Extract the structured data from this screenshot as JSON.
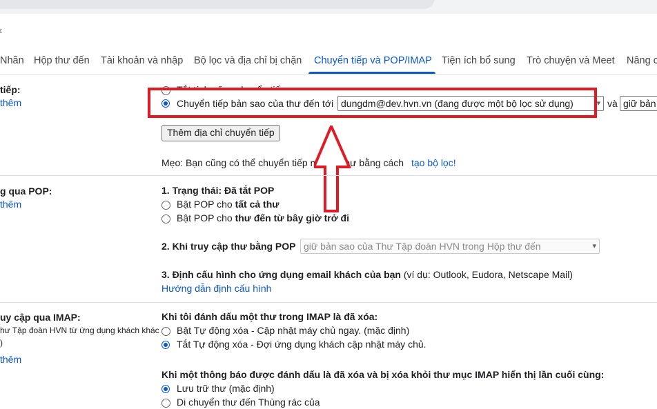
{
  "tabs": [
    {
      "label": "Nhãn"
    },
    {
      "label": "Hộp thư đến"
    },
    {
      "label": "Tài khoản và nhập"
    },
    {
      "label": "Bộ lọc và địa chỉ bị chặn"
    },
    {
      "label": "Chuyển tiếp và POP/IMAP"
    },
    {
      "label": "Tiện ích bổ sung"
    },
    {
      "label": "Trò chuyện và Meet"
    },
    {
      "label": "Nâng c"
    }
  ],
  "forwarding": {
    "section_label": "tiếp:",
    "learn_more": "thêm",
    "disable_option": "Tắt tính năng chuyển tiếp",
    "forward_option": "Chuyển tiếp bản sao của thư đến tới",
    "forward_address": "dungdm@dev.hvn.vn (đang được một bộ lọc sử dụng)",
    "and_text": "và",
    "keep_option": "giữ bản",
    "add_address_button": "Thêm địa chỉ chuyển tiếp",
    "tip_prefix": "Mẹo: Bạn cũng có thể chuyển tiếp một số thư bằng cách",
    "tip_link": "tạo bộ lọc!"
  },
  "pop": {
    "section_label": "g qua POP:",
    "learn_more": "thêm",
    "status_title": "1. Trạng thái: Đã tắt POP",
    "option_all_prefix": "Bật POP cho",
    "option_all_bold": "tất cả thư",
    "option_new_prefix": "Bật POP cho",
    "option_new_bold": "thư đến từ bây giờ trở đi",
    "access_title": "2. Khi truy cập thư bằng POP",
    "access_select": "giữ bản sao của Thư Tập đoàn HVN trong Hộp thư đến",
    "config_title": "3. Định cấu hình cho ứng dụng email khách của bạn",
    "config_examples": "(ví dụ: Outlook, Eudora, Netscape Mail)",
    "config_link": "Hướng dẫn định cấu hình"
  },
  "imap": {
    "section_label": "uy cập qua IMAP:",
    "section_sub": "hư Tập đoàn HVN từ ứng dụng khách khác",
    "section_sub2": ")",
    "learn_more": "thêm",
    "delete_title": "Khi tôi đánh dấu một thư trong IMAP là đã xóa:",
    "auto_expunge_on": "Bật Tự động xóa - Cập nhật máy chủ ngay. (mặc định)",
    "auto_expunge_off": "Tắt Tự động xóa - Đợi ứng dụng khách cập nhật máy chủ.",
    "expunged_title": "Khi một thông báo được đánh dấu là đã xóa và bị xóa khỏi thư mục IMAP hiển thị lần cuối cùng:",
    "archive_option": "Lưu trữ thư (mặc định)",
    "trash_option": "Di chuyển thư đến Thùng rác của"
  },
  "annotation_colors": {
    "highlight": "#e01b24",
    "accent": "#0b57d0"
  }
}
